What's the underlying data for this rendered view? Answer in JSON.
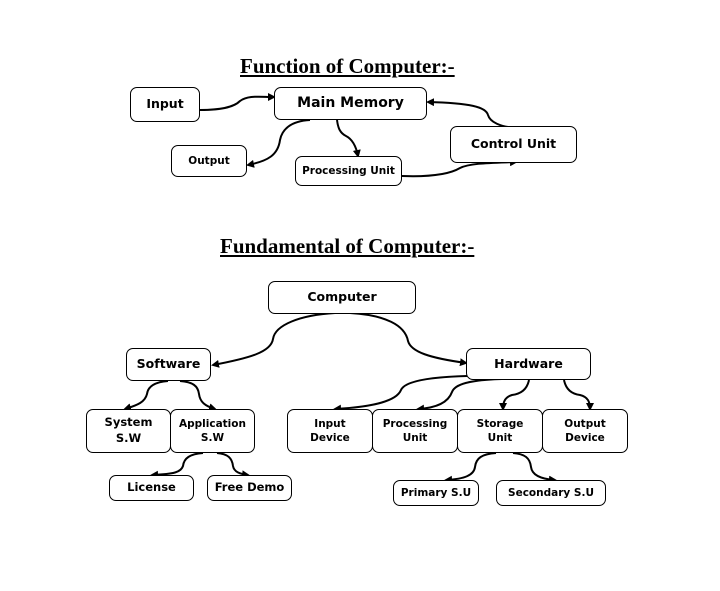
{
  "function_section": {
    "title": "Function of Computer:-",
    "nodes": {
      "input": "Input",
      "main_memory": "Main Memory",
      "output": "Output",
      "processing_unit": "Processing Unit",
      "control_unit": "Control Unit"
    },
    "edges": [
      {
        "from": "input",
        "to": "main_memory"
      },
      {
        "from": "main_memory",
        "to": "output"
      },
      {
        "from": "main_memory",
        "to": "processing_unit"
      },
      {
        "from": "processing_unit",
        "to": "control_unit"
      },
      {
        "from": "control_unit",
        "to": "main_memory"
      }
    ]
  },
  "fundamental_section": {
    "title": "Fundamental of Computer:-",
    "nodes": {
      "computer": "Computer",
      "software": "Software",
      "hardware": "Hardware",
      "system_sw": "System\nS.W",
      "application_sw": "Application\nS.W",
      "license": "License",
      "free_demo": "Free Demo",
      "input_device": "Input\nDevice",
      "processing_unit": "Processing\nUnit",
      "storage_unit": "Storage\nUnit",
      "output_device": "Output\nDevice",
      "primary_su": "Primary S.U",
      "secondary_su": "Secondary S.U"
    },
    "edges": [
      {
        "from": "computer",
        "to": "software"
      },
      {
        "from": "computer",
        "to": "hardware"
      },
      {
        "from": "software",
        "to": "system_sw"
      },
      {
        "from": "software",
        "to": "application_sw"
      },
      {
        "from": "application_sw",
        "to": "license"
      },
      {
        "from": "application_sw",
        "to": "free_demo"
      },
      {
        "from": "hardware",
        "to": "input_device"
      },
      {
        "from": "hardware",
        "to": "processing_unit"
      },
      {
        "from": "hardware",
        "to": "storage_unit"
      },
      {
        "from": "hardware",
        "to": "output_device"
      },
      {
        "from": "storage_unit",
        "to": "primary_su"
      },
      {
        "from": "storage_unit",
        "to": "secondary_su"
      }
    ]
  }
}
